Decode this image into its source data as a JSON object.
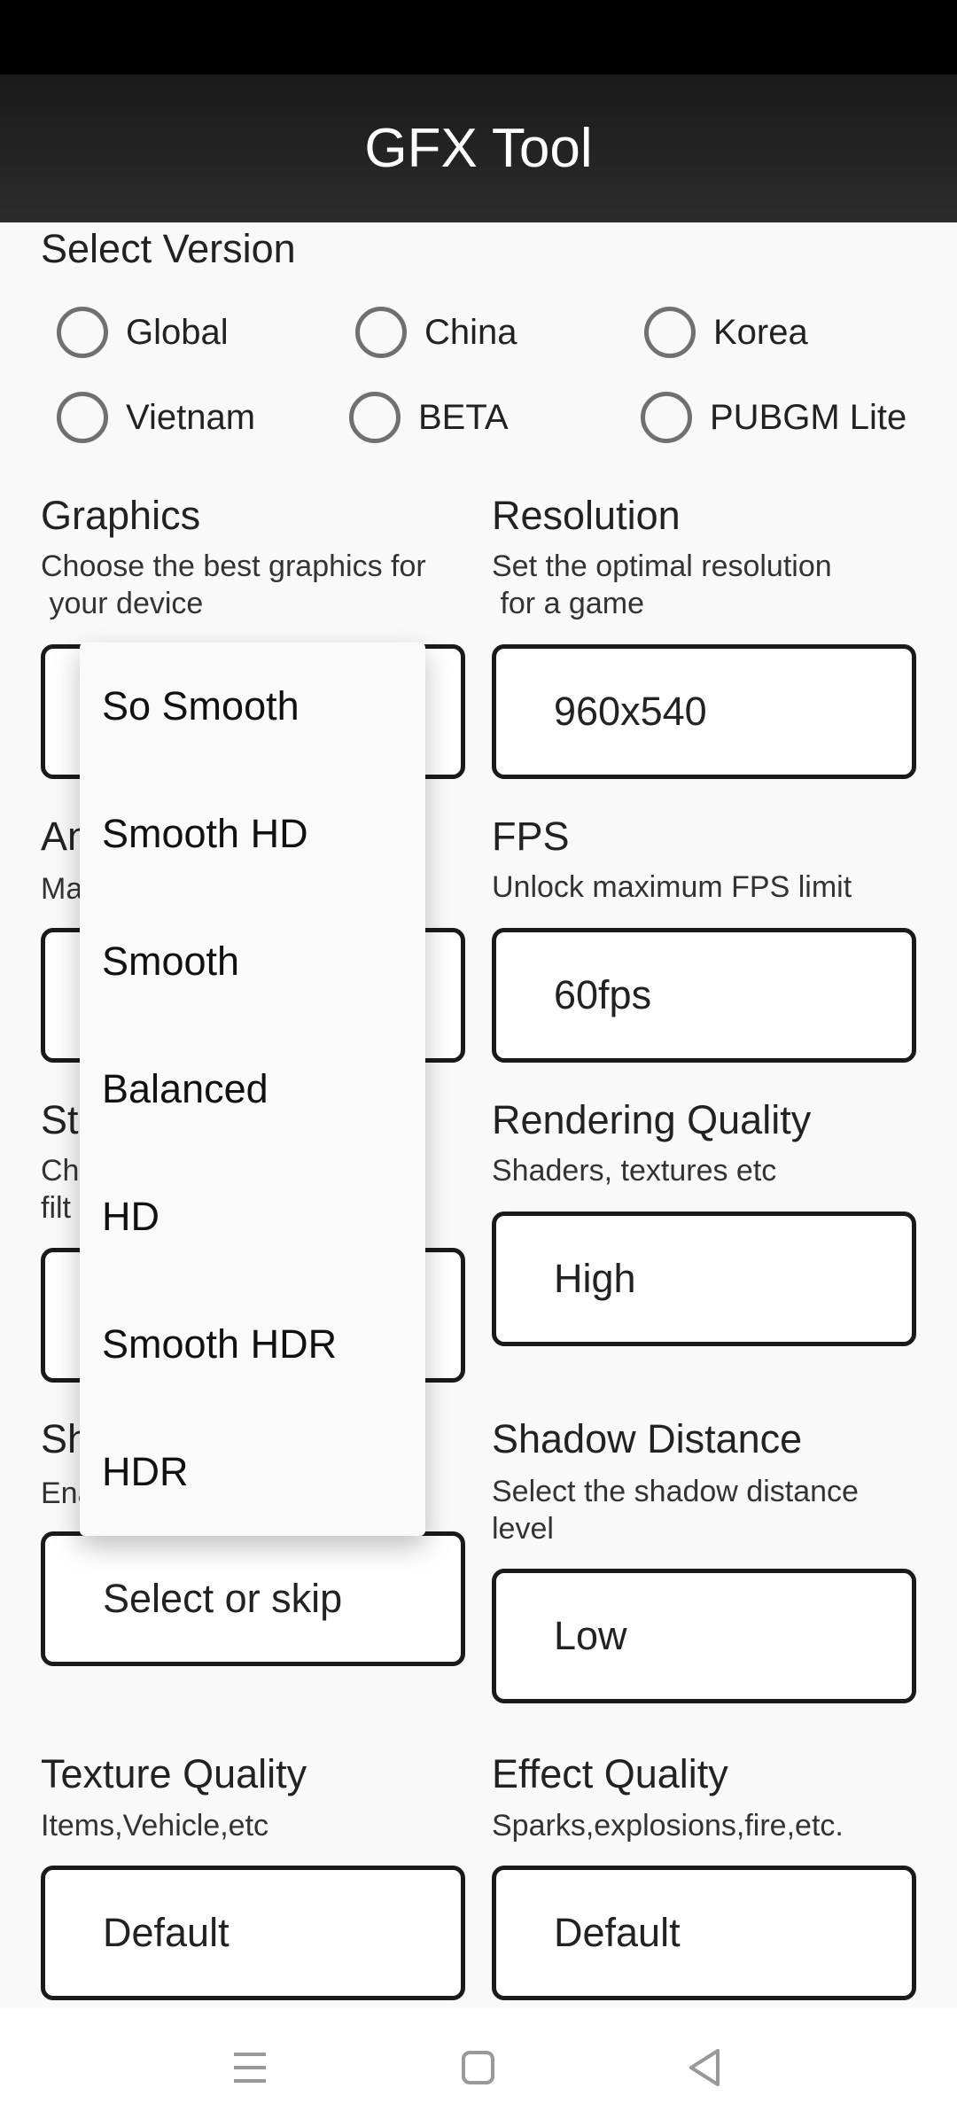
{
  "header": {
    "title": "GFX Tool"
  },
  "version": {
    "label": "Select Version",
    "options": [
      "Global",
      "China",
      "Korea",
      "Vietnam",
      "BETA",
      "PUBGM Lite"
    ]
  },
  "graphics": {
    "label": "Graphics",
    "desc": "Choose the best graphics for\n your device",
    "options": [
      "So Smooth",
      "Smooth HD",
      "Smooth",
      "Balanced",
      "HD",
      "Smooth HDR",
      "HDR"
    ]
  },
  "resolution": {
    "label": "Resolution",
    "desc": "Set the optimal resolution\n for a game",
    "value": "960x540"
  },
  "antialias": {
    "label": "An",
    "desc": "Ma"
  },
  "fps": {
    "label": "FPS",
    "desc": "Unlock maximum FPS limit",
    "value": "60fps"
  },
  "style": {
    "label": "St",
    "desc": "Ch\nfilt"
  },
  "rendering": {
    "label": "Rendering Quality",
    "desc": "Shaders, textures etc",
    "value": "High"
  },
  "shadows": {
    "label": "Sh",
    "desc": "Ena",
    "value": "Select or skip"
  },
  "shadow_distance": {
    "label": "Shadow Distance",
    "desc": "Select the shadow distance\nlevel",
    "value": "Low"
  },
  "texture": {
    "label": "Texture Quality",
    "desc": "Items,Vehicle,etc",
    "value": "Default"
  },
  "effect": {
    "label": "Effect Quality",
    "desc": "Sparks,explosions,fire,etc.",
    "value": "Default"
  },
  "navbar": {
    "icons": [
      "menu-icon",
      "home-icon",
      "back-icon"
    ]
  }
}
